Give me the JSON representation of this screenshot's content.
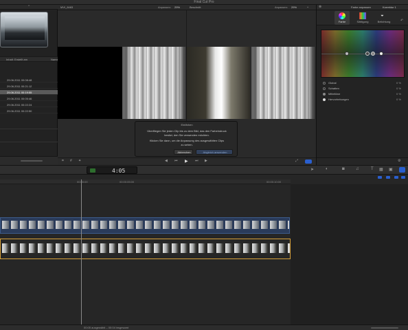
{
  "app": {
    "title": "Final Cut Pro"
  },
  "event_browser": {
    "columns": {
      "name": "Name",
      "start": "Inhalt: Erstellt am"
    },
    "rows": [
      {
        "date": "29.06.2011 00:08:48"
      },
      {
        "date": "29.06.2011 00:21:12"
      },
      {
        "date": "29.06.2011 00:19:55"
      },
      {
        "date": "29.06.2011 00:05:46"
      },
      {
        "date": "29.06.2011 00:22:24"
      },
      {
        "date": "29.06.2011 00:22:50"
      }
    ]
  },
  "viewer": {
    "left": {
      "clip": "MVI_8483",
      "zoom_label": "Anpassen:",
      "zoom": "29%"
    },
    "right": {
      "clip": "Beschnitt",
      "zoom_label": "Anpassen:",
      "zoom": "29%"
    }
  },
  "inspector": {
    "title": "Farbe anpassen",
    "corrections": "Korrektur 1",
    "tabs": [
      {
        "label": "Farbe"
      },
      {
        "label": "Sättigung"
      },
      {
        "label": "Belichtung"
      }
    ],
    "rows": [
      {
        "label": "Global",
        "value": "0 %"
      },
      {
        "label": "Schatten",
        "value": "0 %"
      },
      {
        "label": "Mitteltöne",
        "value": "0 %"
      },
      {
        "label": "Hervorhebungen",
        "value": "0 %"
      }
    ]
  },
  "match_hud": {
    "title": "Einfärben",
    "line1": "Überfliegen Sie jeden Clip bis zu dem Bild, das den Farbeindruck",
    "line2": "besitzt, den Sie verwenden möchten.",
    "line3": "Klicken Sie dann, um die Anpassung des ausgewählten Clips",
    "line4": "zu sehen.",
    "cancel": "Abbrechen",
    "apply": "Abgleich anwenden"
  },
  "dashboard": {
    "timecode": "4:05"
  },
  "timeline": {
    "ruler": [
      {
        "label": "00:00:00"
      },
      {
        "label": "00:00:05:00"
      },
      {
        "label": "00:00:10:00"
      }
    ],
    "status": "00:05 ausgewählt – 00:04 insgesamt"
  }
}
